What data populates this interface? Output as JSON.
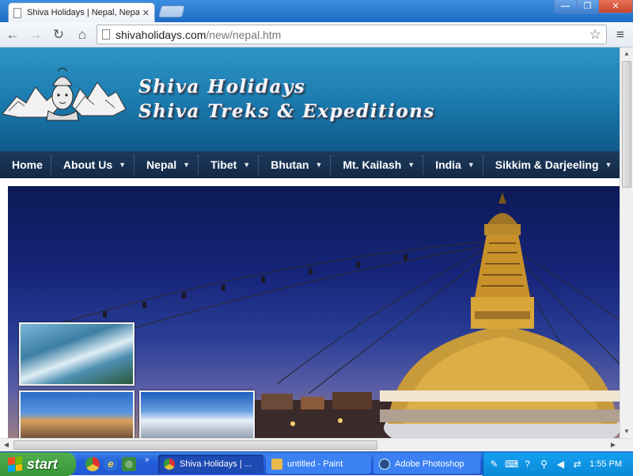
{
  "browser": {
    "tab_title": "Shiva Holidays | Nepal, Nepa",
    "tab_close": "✕",
    "url_host": "shivaholidays.com",
    "url_path": "/new/nepal.htm",
    "window_buttons": {
      "minimize": "—",
      "maximize": "❐",
      "close": "✕"
    },
    "nav_glyphs": {
      "back": "←",
      "forward": "→",
      "reload": "↻",
      "home": "⌂",
      "star": "☆",
      "menu": "≡"
    }
  },
  "site": {
    "title_line1": "Shiva Holidays",
    "title_line2": "Shiva Treks & Expeditions",
    "nav": [
      {
        "label": "Home",
        "has_dropdown": false
      },
      {
        "label": "About Us",
        "has_dropdown": true
      },
      {
        "label": "Nepal",
        "has_dropdown": true
      },
      {
        "label": "Tibet",
        "has_dropdown": true
      },
      {
        "label": "Bhutan",
        "has_dropdown": true
      },
      {
        "label": "Mt. Kailash",
        "has_dropdown": true
      },
      {
        "label": "India",
        "has_dropdown": true
      },
      {
        "label": "Sikkim & Darjeeling",
        "has_dropdown": true
      }
    ],
    "dropdown_caret": "▼",
    "colors": {
      "header_top": "#2f93c4",
      "header_bottom": "#0f5a8a",
      "nav_bg": "#1e3a5c",
      "title_text": "#f4f6fa"
    }
  },
  "taskbar": {
    "start_label": "start",
    "more_label": "»",
    "tasks": [
      {
        "label": "Shiva Holidays | ...",
        "icon": "chrome-icon",
        "active": true
      },
      {
        "label": "untitled - Paint",
        "icon": "paint-icon",
        "active": false
      },
      {
        "label": "Adobe Photoshop",
        "icon": "photoshop-icon",
        "active": false
      }
    ],
    "clock": "1:55 PM"
  }
}
